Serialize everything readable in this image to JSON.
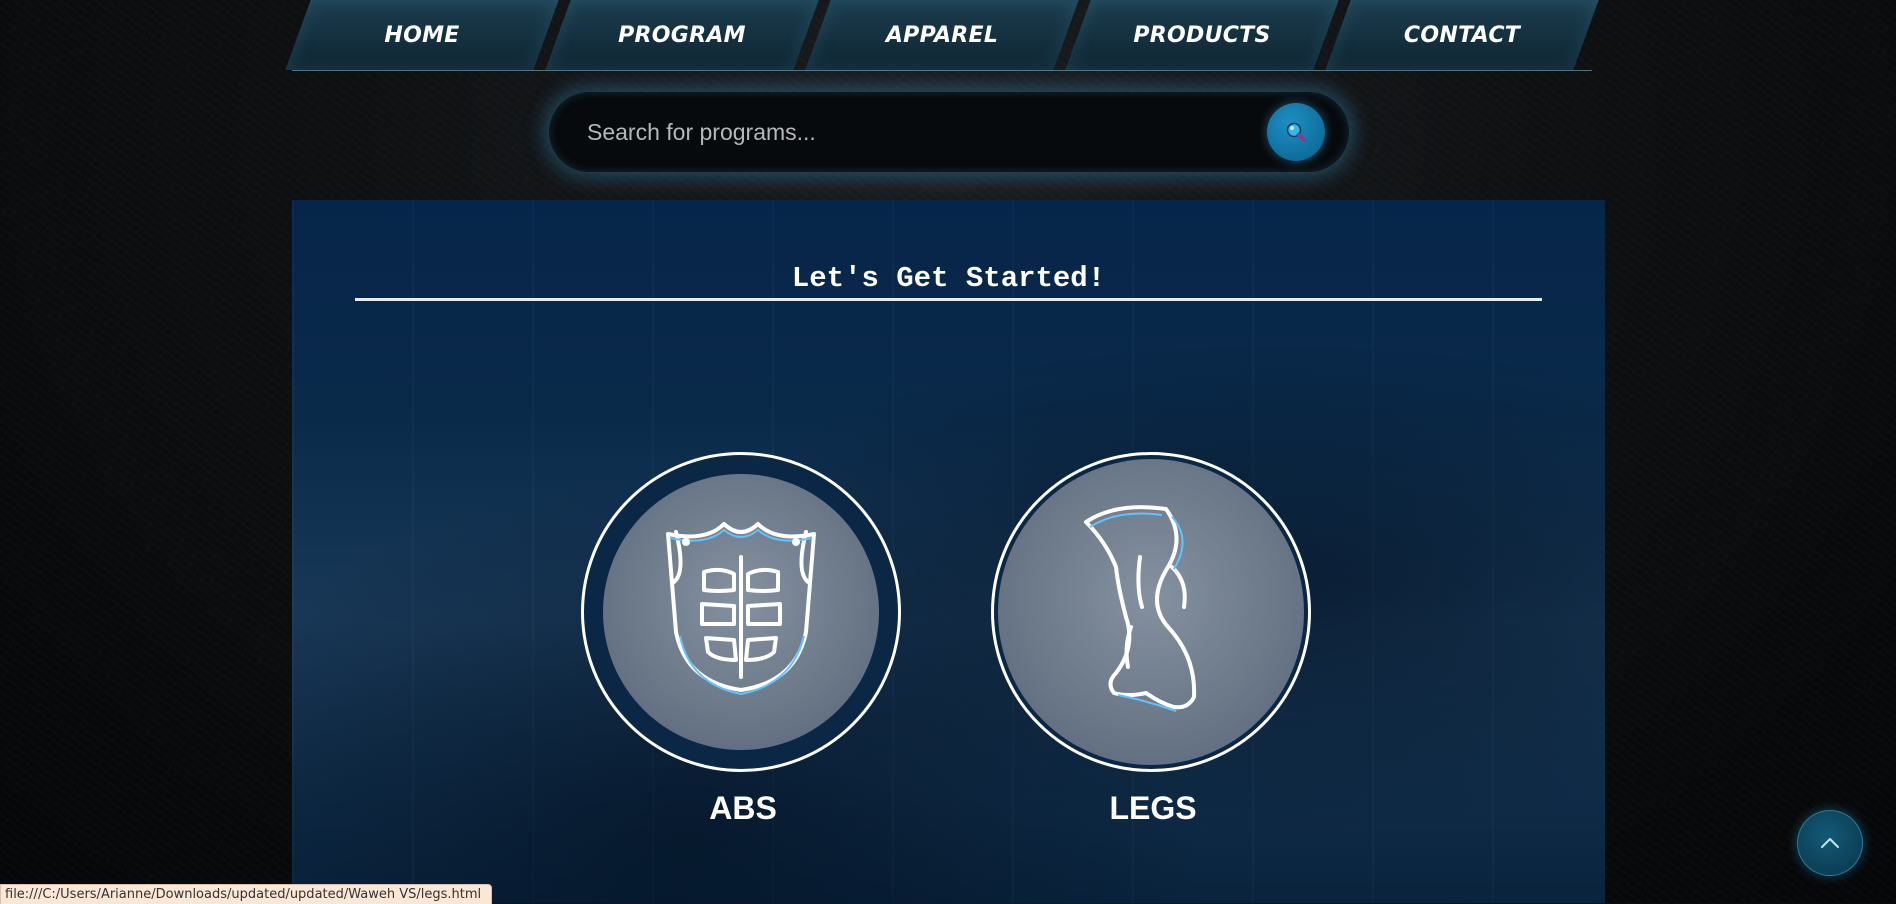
{
  "nav": {
    "items": [
      {
        "label": "HOME"
      },
      {
        "label": "PROGRAM"
      },
      {
        "label": "APPAREL"
      },
      {
        "label": "PRODUCTS"
      },
      {
        "label": "CONTACT"
      }
    ]
  },
  "search": {
    "placeholder": "Search for programs...",
    "value": "",
    "button_icon": "search-icon"
  },
  "main": {
    "heading": "Let's Get Started!",
    "cards": [
      {
        "label": "ABS",
        "icon": "abs-icon"
      },
      {
        "label": "LEGS",
        "icon": "leg-icon"
      }
    ]
  },
  "scroll_top": {
    "icon": "chevron-up-icon"
  },
  "status_bar": {
    "url": "file:///C:/Users/Arianne/Downloads/updated/updated/Waweh VS/legs.html"
  },
  "colors": {
    "accent": "#0f6e9c",
    "panel": "#0a2a4a",
    "nav_tab": "#14303f",
    "status_bg": "#fbe7d6"
  }
}
